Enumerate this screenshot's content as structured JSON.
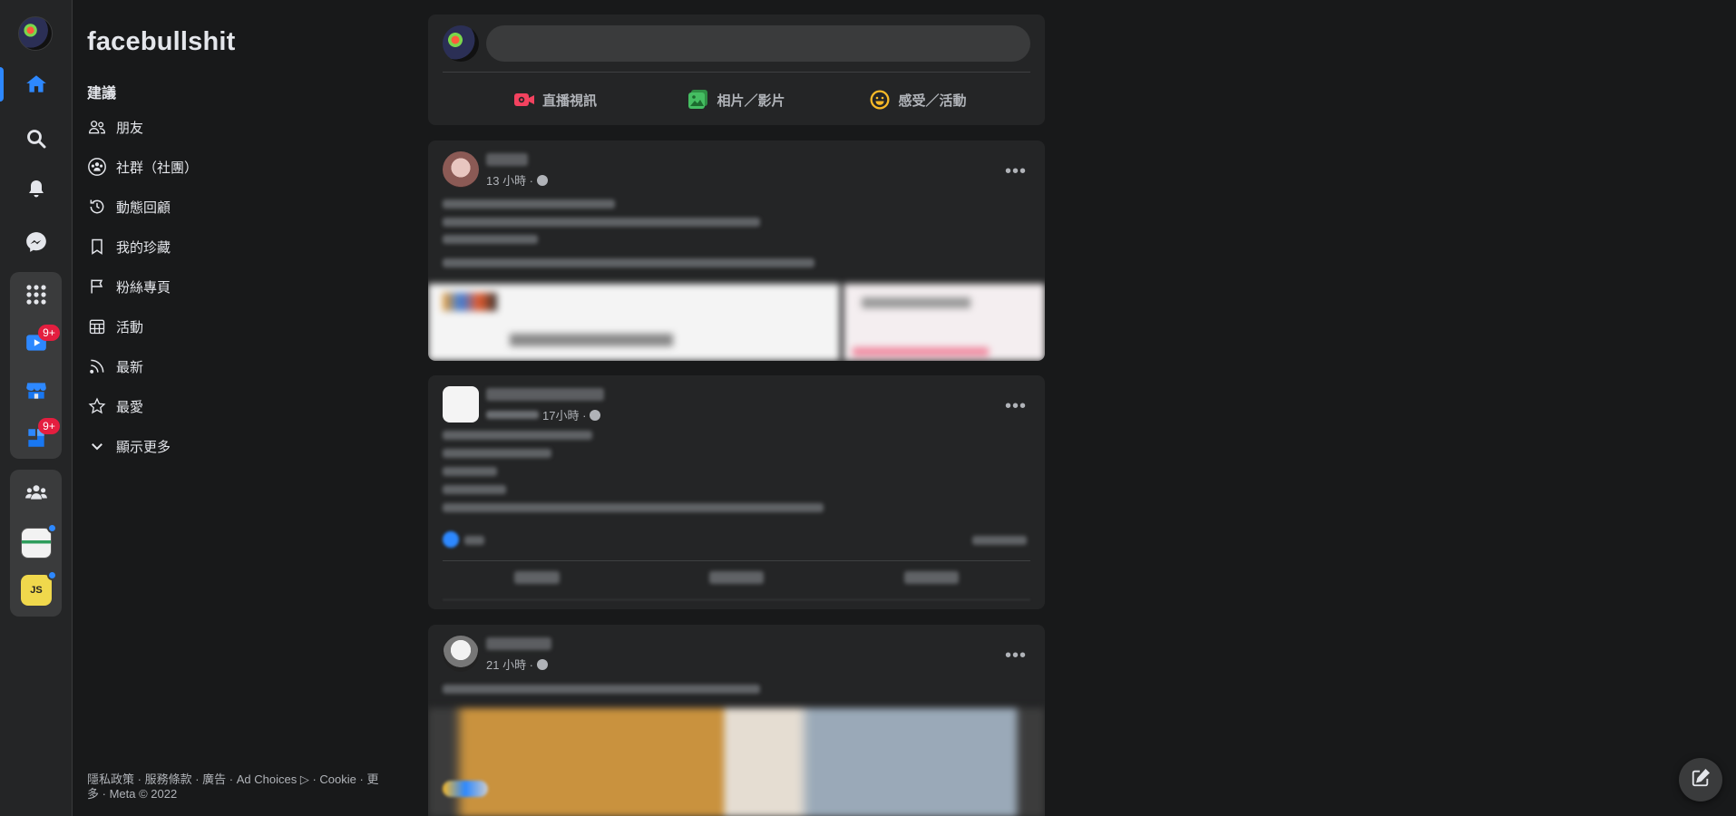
{
  "brand": {
    "title": "facebullshit"
  },
  "menu": {
    "heading": "建議",
    "items": [
      {
        "label": "朋友",
        "icon": "friends-icon"
      },
      {
        "label": "社群（社團）",
        "icon": "groups-icon"
      },
      {
        "label": "動態回顧",
        "icon": "memories-icon"
      },
      {
        "label": "我的珍藏",
        "icon": "saved-icon"
      },
      {
        "label": "粉絲專頁",
        "icon": "pages-icon"
      },
      {
        "label": "活動",
        "icon": "events-icon"
      },
      {
        "label": "最新",
        "icon": "feed-icon"
      },
      {
        "label": "最愛",
        "icon": "favorites-icon"
      },
      {
        "label": "顯示更多",
        "icon": "chevron-down-icon"
      }
    ]
  },
  "footer": {
    "links": [
      "隱私政策",
      "服務條款",
      "廣告",
      "Ad Choices",
      "Cookie",
      "更多"
    ],
    "copyright": "Meta © 2022"
  },
  "rail": {
    "icons": [
      "home-icon",
      "search-icon",
      "notifications-icon",
      "messenger-icon",
      "apps-grid-icon",
      "watch-icon",
      "marketplace-icon",
      "gaming-icon",
      "groups-icon",
      "group-avatar-frontend",
      "group-avatar-js"
    ],
    "badges": {
      "watch": "9+",
      "gaming": "9+"
    },
    "js_label": "JS"
  },
  "composer": {
    "placeholder": "",
    "actions": [
      {
        "label": "直播視訊",
        "icon": "live-video-icon"
      },
      {
        "label": "相片／影片",
        "icon": "photo-video-icon"
      },
      {
        "label": "感受／活動",
        "icon": "feeling-icon"
      }
    ]
  },
  "posts": [
    {
      "time": "13 小時 ·"
    },
    {
      "time": "17小時 ·"
    },
    {
      "time": "21 小時 ·"
    }
  ],
  "colors": {
    "background": "#18191a",
    "surface": "#242526",
    "accent": "#2d88ff",
    "badge": "#e41e3f",
    "live_red": "#f3425f",
    "photo_green": "#45bd62",
    "feeling_yellow": "#f7b928"
  }
}
